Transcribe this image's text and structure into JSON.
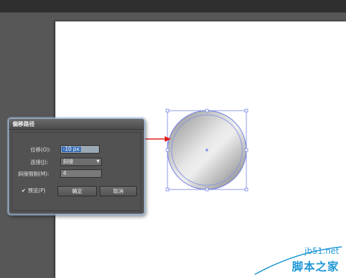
{
  "dialog": {
    "title": "偏移路径",
    "offset_label": "位移(O):",
    "offset_value": "-10 px",
    "joins_label": "连接(J):",
    "joins_value": "斜接",
    "miter_label": "斜接限制(M):",
    "miter_value": "4",
    "preview_label": "预览(P)",
    "preview_checked": true,
    "ok_label": "确定",
    "cancel_label": "取消"
  },
  "colors": {
    "annotation_arrow": "#e01818",
    "selection": "#6f7fe6",
    "watermark": "#1d97d6"
  },
  "watermark": {
    "site": "jb51.net",
    "brand": "脚本之家"
  }
}
